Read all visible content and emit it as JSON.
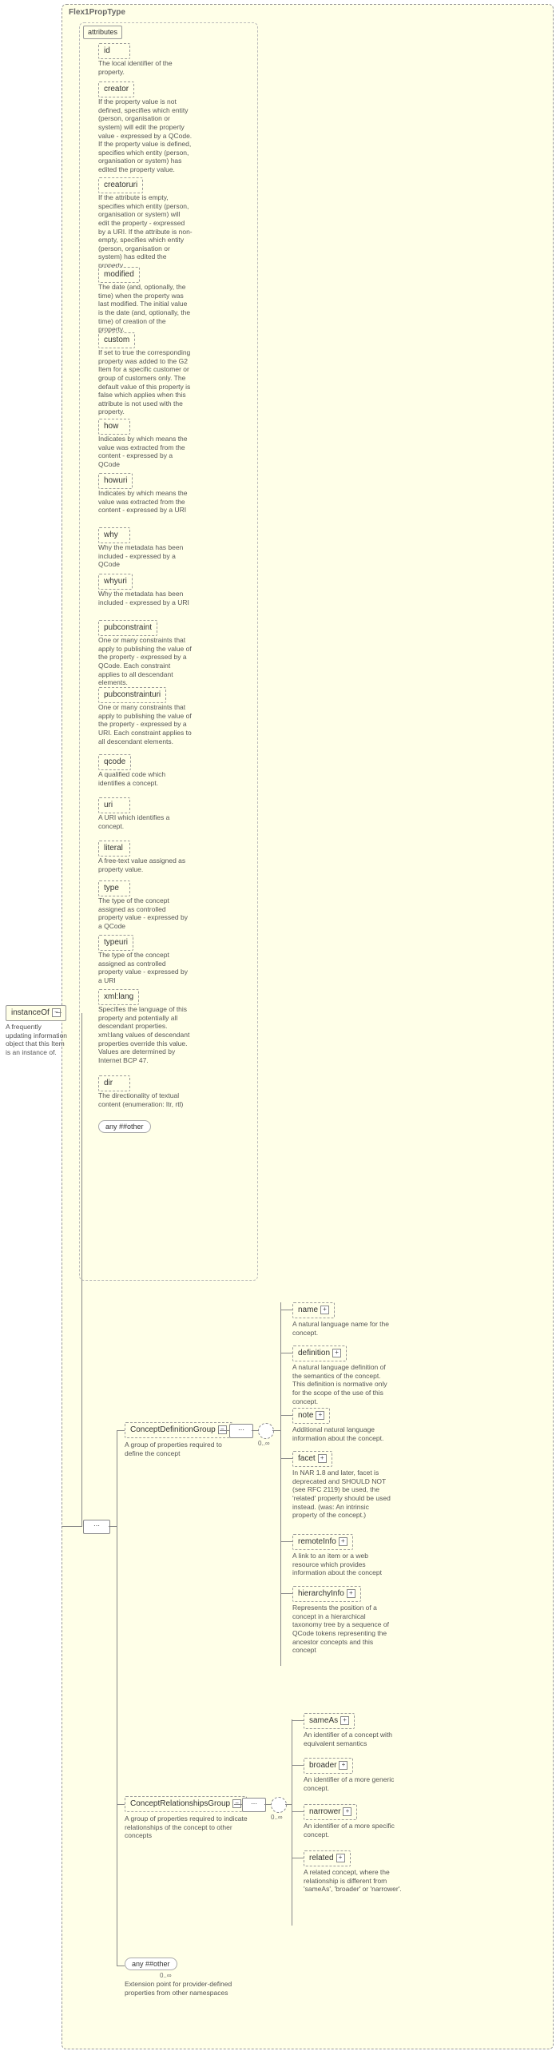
{
  "root": {
    "name": "instanceOf",
    "desc": "A frequently updating information object that this Item is an instance of."
  },
  "type": {
    "label": "Flex1PropType"
  },
  "attributes": {
    "header": "attributes",
    "items": [
      {
        "name": "id",
        "desc": "The local identifier of the property."
      },
      {
        "name": "creator",
        "desc": "If the property value is not defined, specifies which entity (person, organisation or system) will edit the property value - expressed by a QCode. If the property value is defined, specifies which entity (person, organisation or system) has edited the property value."
      },
      {
        "name": "creatoruri",
        "desc": "If the attribute is empty, specifies which entity (person, organisation or system) will edit the property - expressed by a URI. If the attribute is non-empty, specifies which entity (person, organisation or system) has edited the property."
      },
      {
        "name": "modified",
        "desc": "The date (and, optionally, the time) when the property was last modified. The initial value is the date (and, optionally, the time) of creation of the property."
      },
      {
        "name": "custom",
        "desc": "If set to true the corresponding property was added to the G2 Item for a specific customer or group of customers only. The default value of this property is false which applies when this attribute is not used with the property."
      },
      {
        "name": "how",
        "desc": "Indicates by which means the value was extracted from the content - expressed by a QCode"
      },
      {
        "name": "howuri",
        "desc": "Indicates by which means the value was extracted from the content - expressed by a URI"
      },
      {
        "name": "why",
        "desc": "Why the metadata has been included - expressed by a QCode"
      },
      {
        "name": "whyuri",
        "desc": "Why the metadata has been included - expressed by a URI"
      },
      {
        "name": "pubconstraint",
        "desc": "One or many constraints that apply to publishing the value of the property - expressed by a QCode. Each constraint applies to all descendant elements."
      },
      {
        "name": "pubconstrainturi",
        "desc": "One or many constraints that apply to publishing the value of the property - expressed by a URI. Each constraint applies to all descendant elements."
      },
      {
        "name": "qcode",
        "desc": "A qualified code which identifies a concept."
      },
      {
        "name": "uri",
        "desc": "A URI which identifies a concept."
      },
      {
        "name": "literal",
        "desc": "A free-text value assigned as property value."
      },
      {
        "name": "type",
        "desc": "The type of the concept assigned as controlled property value - expressed by a QCode"
      },
      {
        "name": "typeuri",
        "desc": "The type of the concept assigned as controlled property value - expressed by a URI"
      },
      {
        "name": "xml:lang",
        "desc": "Specifies the language of this property and potentially all descendant properties. xml:lang values of descendant properties override this value. Values are determined by Internet BCP 47."
      },
      {
        "name": "dir",
        "desc": "The directionality of textual content (enumeration: ltr, rtl)"
      },
      {
        "name": "any ##other",
        "desc": ""
      }
    ]
  },
  "groups": {
    "def": {
      "label": "ConceptDefinitionGroup",
      "desc": "A group of properties required to define the concept",
      "card": "0..∞"
    },
    "rel": {
      "label": "ConceptRelationshipsGroup",
      "desc": "A group of properties required to indicate relationships of the concept to other concepts",
      "card": "0..∞"
    },
    "any": {
      "label": "any ##other",
      "desc": "Extension point for provider-defined properties from other namespaces",
      "card": "0..∞"
    }
  },
  "def_children": [
    {
      "name": "name",
      "desc": "A natural language name for the concept."
    },
    {
      "name": "definition",
      "desc": "A natural language definition of the semantics of the concept. This definition is normative only for the scope of the use of this concept."
    },
    {
      "name": "note",
      "desc": "Additional natural language information about the concept."
    },
    {
      "name": "facet",
      "desc": "In NAR 1.8 and later, facet is deprecated and SHOULD NOT (see RFC 2119) be used, the 'related' property should be used instead. (was: An intrinsic property of the concept.)"
    },
    {
      "name": "remoteInfo",
      "desc": "A link to an item or a web resource which provides information about the concept"
    },
    {
      "name": "hierarchyInfo",
      "desc": "Represents the position of a concept in a hierarchical taxonomy tree by a sequence of QCode tokens representing the ancestor concepts and this concept"
    }
  ],
  "rel_children": [
    {
      "name": "sameAs",
      "desc": "An identifier of a concept with equivalent semantics"
    },
    {
      "name": "broader",
      "desc": "An identifier of a more generic concept."
    },
    {
      "name": "narrower",
      "desc": "An identifier of a more specific concept."
    },
    {
      "name": "related",
      "desc": "A related concept, where the relationship is different from 'sameAs', 'broader' or 'narrower'."
    }
  ]
}
